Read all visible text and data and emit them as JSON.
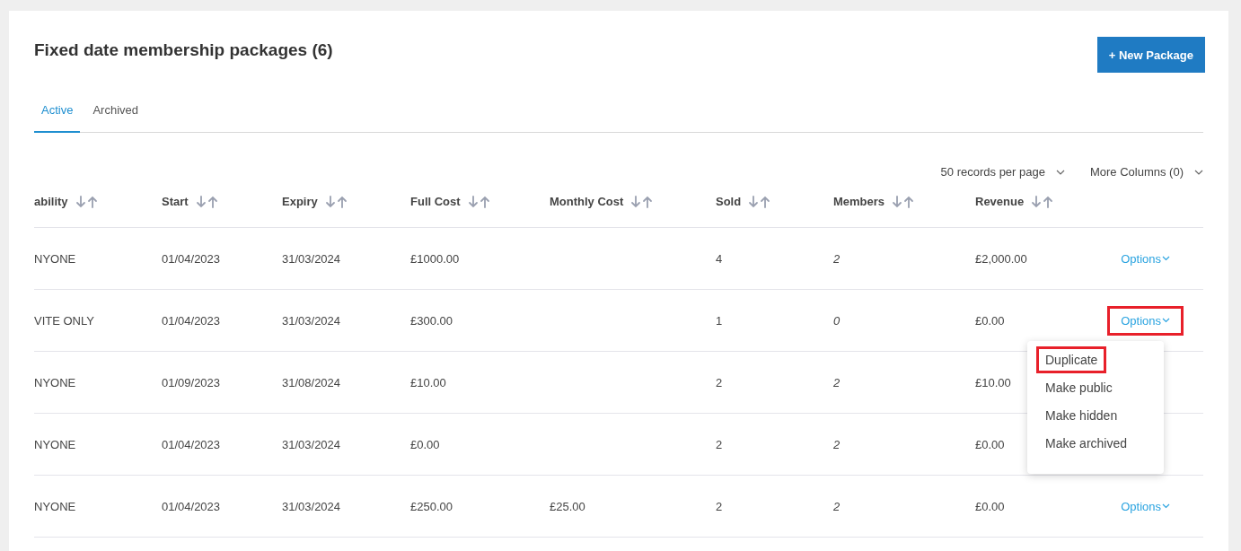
{
  "title": "Fixed date membership packages (6)",
  "new_button": "+ New Package",
  "tabs": [
    {
      "label": "Active",
      "selected": true
    },
    {
      "label": "Archived",
      "selected": false
    }
  ],
  "records_per_page": "50 records per page",
  "more_columns": "More Columns (0)",
  "table": {
    "columns": [
      "ability",
      "Start",
      "Expiry",
      "Full Cost",
      "Monthly Cost",
      "Sold",
      "Members",
      "Revenue"
    ],
    "rows": [
      {
        "cells": [
          "NYONE",
          "01/04/2023",
          "31/03/2024",
          "£1000.00",
          "",
          "4",
          "2",
          "£2,000.00"
        ],
        "options": {
          "label": "Options",
          "highlighted": false
        }
      },
      {
        "cells": [
          "VITE ONLY",
          "01/04/2023",
          "31/03/2024",
          "£300.00",
          "",
          "1",
          "0",
          "£0.00"
        ],
        "options": {
          "label": "Options",
          "highlighted": true
        }
      },
      {
        "cells": [
          "NYONE",
          "01/09/2023",
          "31/08/2024",
          "£10.00",
          "",
          "2",
          "2",
          "£10.00"
        ],
        "options": null
      },
      {
        "cells": [
          "NYONE",
          "01/04/2023",
          "31/03/2024",
          "£0.00",
          "",
          "2",
          "2",
          "£0.00"
        ],
        "options": null
      },
      {
        "cells": [
          "NYONE",
          "01/04/2023",
          "31/03/2024",
          "£250.00",
          "£25.00",
          "2",
          "2",
          "£0.00"
        ],
        "options": {
          "label": "Options",
          "highlighted": false
        }
      }
    ]
  },
  "options_menu": {
    "items": [
      {
        "label": "Duplicate",
        "highlighted": true
      },
      {
        "label": "Make public",
        "highlighted": false
      },
      {
        "label": "Make hidden",
        "highlighted": false
      },
      {
        "label": "Make archived",
        "highlighted": false
      }
    ]
  }
}
